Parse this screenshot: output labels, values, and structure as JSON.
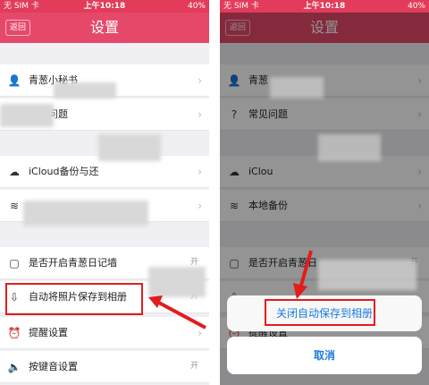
{
  "status": {
    "carrier": "无 SIM 卡",
    "time": "上午10:18",
    "battery": "40%"
  },
  "header": {
    "back": "返回",
    "title": "设置"
  },
  "left_rows": [
    {
      "icon": "person-icon",
      "glyph": "👤",
      "label": "青葱小秘书",
      "right": "›"
    },
    {
      "icon": "help-icon",
      "glyph": "?",
      "label": "常见问题",
      "right": "›"
    },
    {
      "icon": "cloud-icon",
      "glyph": "☁",
      "label": "iCloud备份与还",
      "right": "›"
    },
    {
      "icon": "wifi-icon",
      "glyph": "≋",
      "label": "",
      "right": "›"
    },
    {
      "icon": "diary-icon",
      "glyph": "▢",
      "label": "是否开启青葱日记墙",
      "right": "开"
    },
    {
      "icon": "download-icon",
      "glyph": "⇩",
      "label": "自动将照片保存到相册",
      "right": "开"
    },
    {
      "icon": "alarm-icon",
      "glyph": "⏰",
      "label": "提醒设置",
      "right": "›"
    },
    {
      "icon": "speaker-icon",
      "glyph": "🔈",
      "label": "按键音设置",
      "right": "开"
    }
  ],
  "right_rows": [
    {
      "icon": "person-icon",
      "glyph": "👤",
      "label": "青葱",
      "right": "›"
    },
    {
      "icon": "help-icon",
      "glyph": "?",
      "label": "常见问题",
      "right": "›"
    },
    {
      "icon": "cloud-icon",
      "glyph": "☁",
      "label": "iClou",
      "right": "›"
    },
    {
      "icon": "wifi-icon",
      "glyph": "≋",
      "label": "本地备份",
      "right": "›"
    },
    {
      "icon": "diary-icon",
      "glyph": "▢",
      "label": "是否开启青葱日",
      "right": "开"
    },
    {
      "icon": "download-icon",
      "glyph": "⇩",
      "label": "",
      "right": ""
    },
    {
      "icon": "alarm-icon",
      "glyph": "⏰",
      "label": "提醒设置",
      "right": ""
    }
  ],
  "action_sheet": {
    "option": "关闭自动保存到相册",
    "cancel": "取消"
  },
  "colors": {
    "header": "#e6486a",
    "highlight": "#e21c1c",
    "link": "#1a7be0"
  }
}
